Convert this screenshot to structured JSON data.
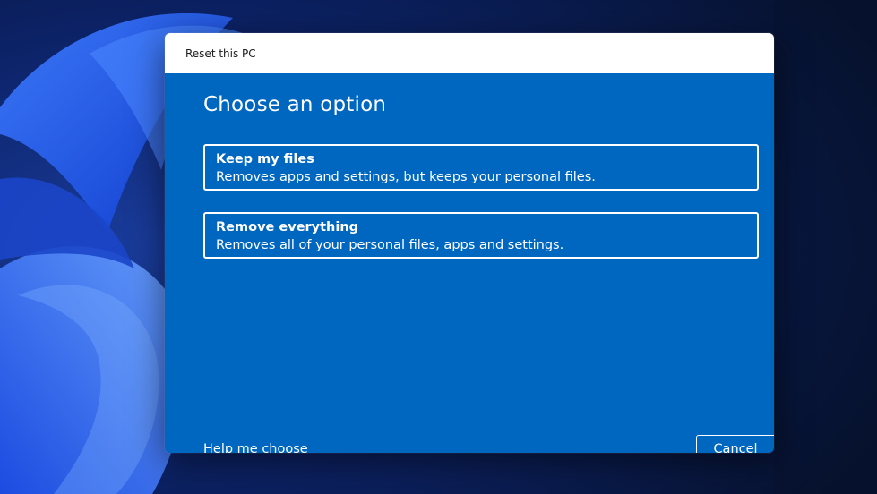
{
  "dialog": {
    "title": "Reset this PC",
    "heading": "Choose an option",
    "options": [
      {
        "title": "Keep my files",
        "description": "Removes apps and settings, but keeps your personal files."
      },
      {
        "title": "Remove everything",
        "description": "Removes all of your personal files, apps and settings."
      }
    ],
    "help_link": "Help me choose",
    "cancel_label": "Cancel"
  },
  "colors": {
    "dialog_background": "#0067c0",
    "titlebar_background": "#ffffff",
    "text": "#ffffff",
    "desktop_background": "#0a1a4a"
  }
}
